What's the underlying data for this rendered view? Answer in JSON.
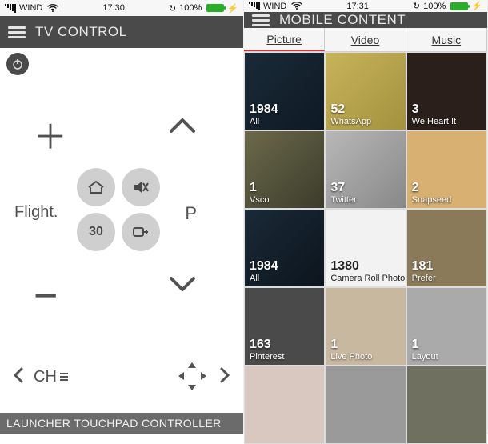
{
  "left": {
    "statusbar": {
      "carrier": "WIND",
      "time": "17:30",
      "battery_pct": "100%"
    },
    "title": "TV CONTROL",
    "labels": {
      "flight": "Flight.",
      "p": "P",
      "center_30": "30",
      "ch": "CH"
    },
    "launcher_text": "LAUNCHER TOUCHPAD CONTROLLER"
  },
  "right": {
    "statusbar": {
      "carrier": "WIND",
      "time": "17:31",
      "battery_pct": "100%"
    },
    "title": "MOBILE CONTENT",
    "tabs": {
      "picture": "Picture",
      "video": "Video",
      "music": "Music"
    },
    "albums": [
      {
        "count": "1984",
        "name": "All"
      },
      {
        "count": "52",
        "name": "WhatsApp"
      },
      {
        "count": "3",
        "name": "We Heart It"
      },
      {
        "count": "1",
        "name": "Vsco"
      },
      {
        "count": "37",
        "name": "Twitter"
      },
      {
        "count": "2",
        "name": "Snapseed"
      },
      {
        "count": "1984",
        "name": "All"
      },
      {
        "count": "1380",
        "name": "Camera Roll Photo"
      },
      {
        "count": "181",
        "name": "Prefer"
      },
      {
        "count": "163",
        "name": "Pinterest"
      },
      {
        "count": "1",
        "name": "Live Photo"
      },
      {
        "count": "1",
        "name": "Layout"
      },
      {
        "count": "",
        "name": ""
      },
      {
        "count": "",
        "name": ""
      },
      {
        "count": "",
        "name": ""
      }
    ]
  }
}
